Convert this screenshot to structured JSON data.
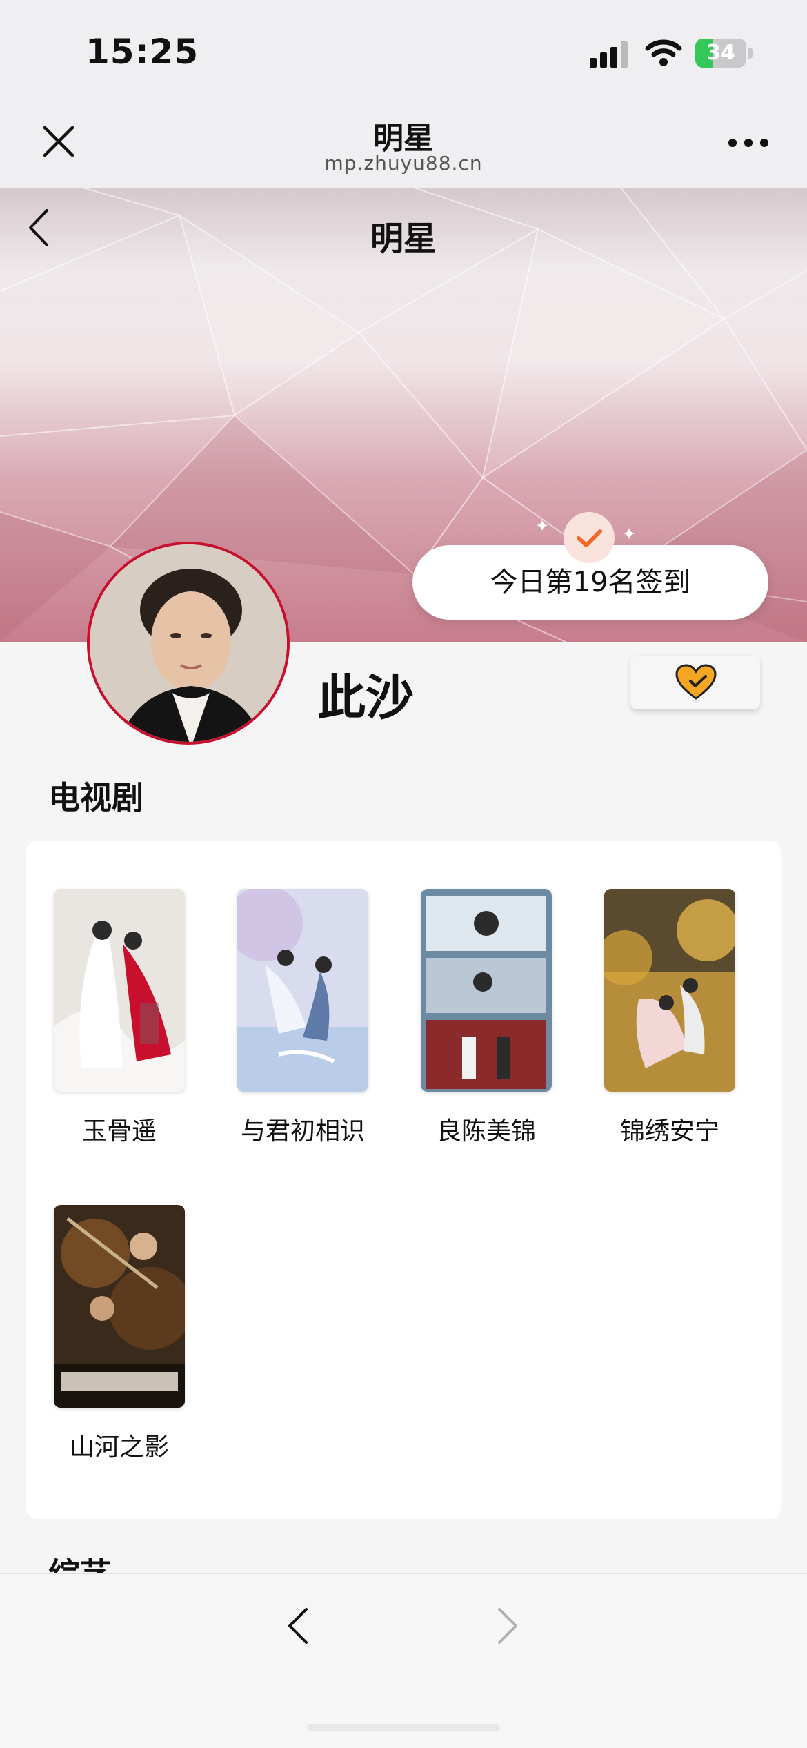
{
  "status_bar": {
    "time": "15:25",
    "battery_percent": "34"
  },
  "miniprogram_nav": {
    "title": "明星",
    "domain": "mp.zhuyu88.cn"
  },
  "page": {
    "title": "明星"
  },
  "checkin": {
    "text": "今日第19名签到"
  },
  "profile": {
    "name": "此沙"
  },
  "sections": {
    "tv_title": "电视剧",
    "variety_title": "综艺"
  },
  "tv_dramas": [
    {
      "title": "玉骨遥"
    },
    {
      "title": "与君初相识"
    },
    {
      "title": "良陈美锦"
    },
    {
      "title": "锦绣安宁"
    },
    {
      "title": "山河之影"
    }
  ],
  "colors": {
    "accent": "#c8102e",
    "brand_pink": "#c77d8d",
    "heart": "#f5a623",
    "check": "#f06a2a"
  }
}
